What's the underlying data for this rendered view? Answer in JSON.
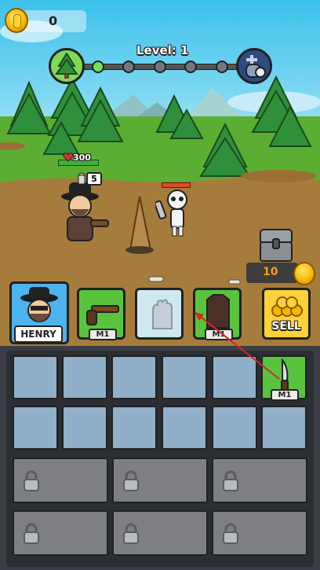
{
  "hud": {
    "coins": "0",
    "level_label": "Level: 1",
    "stage_icons": [
      "forest-icon",
      "graveyard-icon"
    ]
  },
  "player": {
    "hp": "300",
    "ammo": "5"
  },
  "chest": {
    "price": "10"
  },
  "hero": {
    "name": "HENRY"
  },
  "equipment": {
    "slot_weapon_level": "M1",
    "slot_armor_level": "M1",
    "slot_gloves_icon": "glove-icon"
  },
  "actions": {
    "sell_label": "SELL"
  },
  "inventory": {
    "item_level": "M1",
    "item_icon": "knife-icon"
  },
  "colors": {
    "slot_green": "#58c43d",
    "empty_cell": "#8fb0c8",
    "locked_cell": "#7d7f83",
    "accent_gold": "#ffd23b",
    "hp_green": "#3fb13a",
    "enemy_hp_red": "#e14b25"
  }
}
